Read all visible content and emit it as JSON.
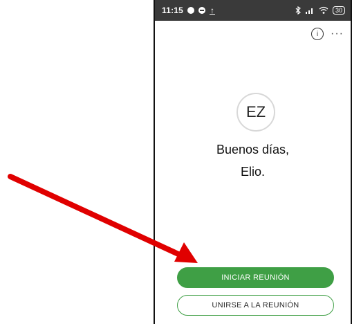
{
  "status_bar": {
    "time": "11:15",
    "battery": "30",
    "icons": [
      "notification-icon",
      "minus-circle-icon",
      "upload-icon",
      "bluetooth-icon",
      "signal-icon",
      "wifi-icon",
      "battery-icon"
    ]
  },
  "toolbar": {
    "info_glyph": "i",
    "more_glyph": "···"
  },
  "profile": {
    "initials": "EZ",
    "greeting": "Buenos días,",
    "name": "Elio."
  },
  "actions": {
    "start_meeting": "INICIAR REUNIÓN",
    "join_meeting": "UNIRSE A LA REUNIÓN"
  },
  "colors": {
    "accent": "#3f9f45",
    "annotation_arrow": "#e00000",
    "status_bar_bg": "#3a3a3a"
  }
}
